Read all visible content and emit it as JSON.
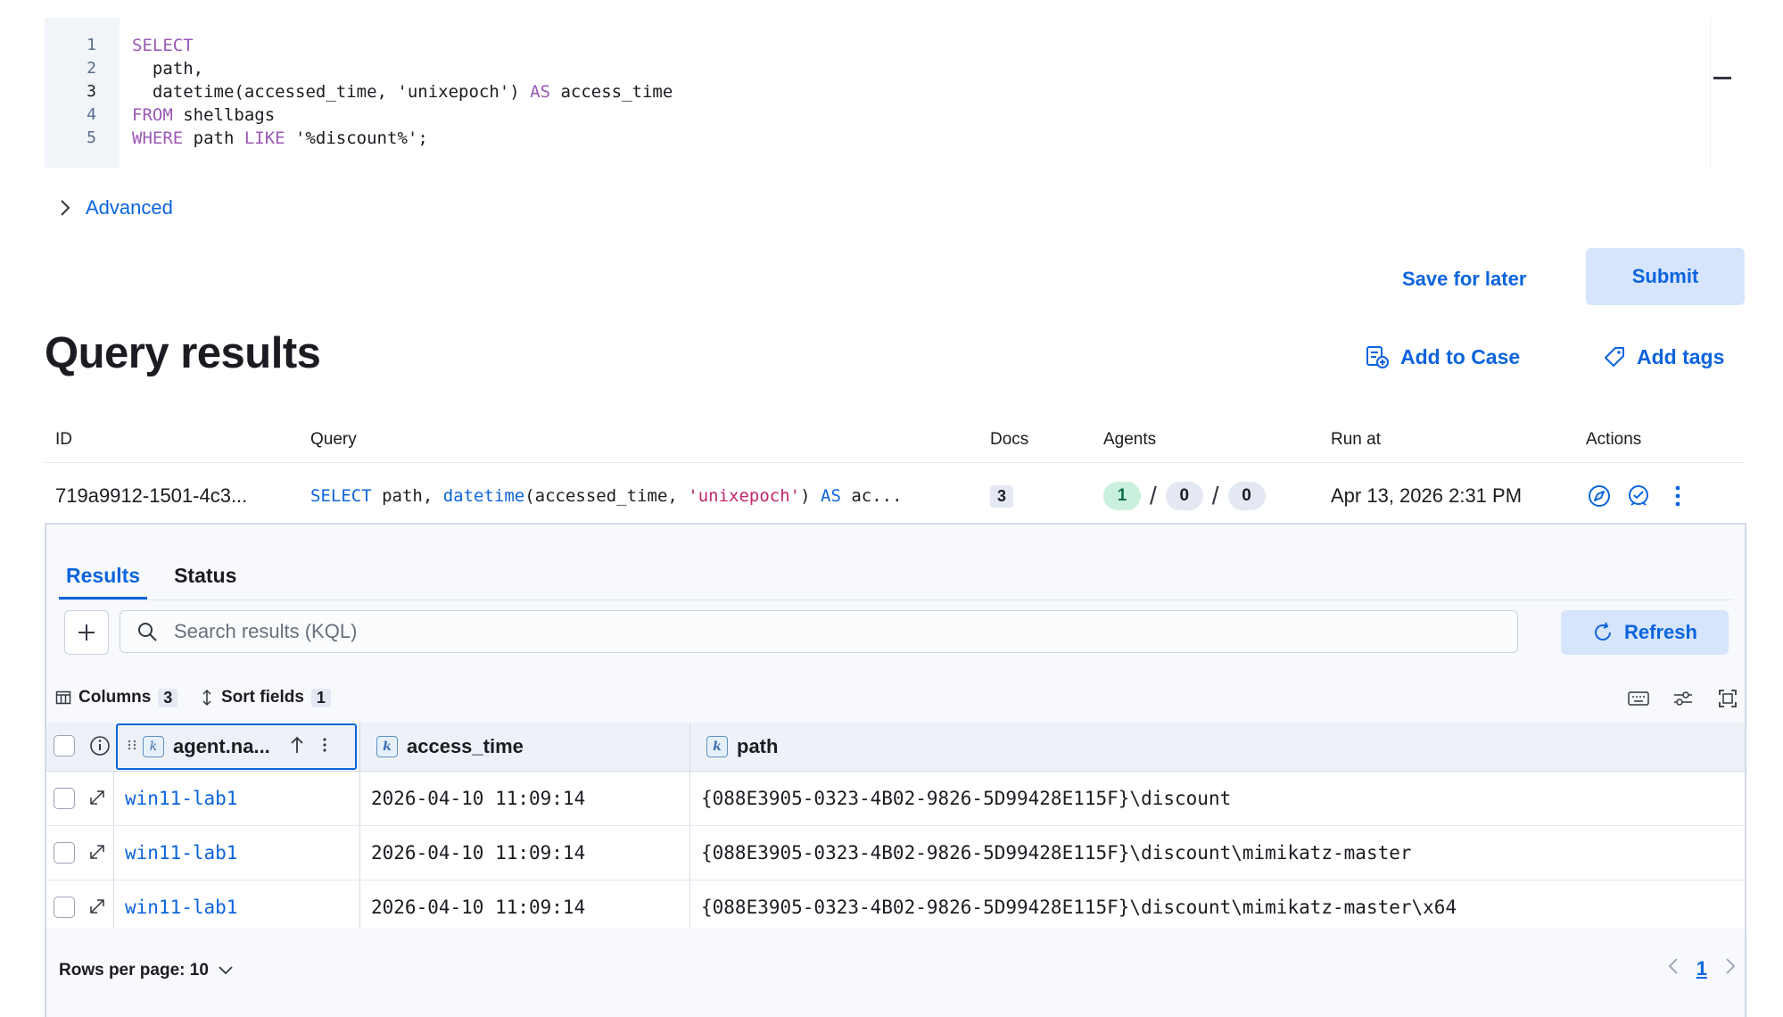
{
  "editor": {
    "lines": [
      {
        "num": "1"
      },
      {
        "num": "2"
      },
      {
        "num": "3"
      },
      {
        "num": "4"
      },
      {
        "num": "5"
      }
    ],
    "line1": {
      "kw": "SELECT"
    },
    "line2": {
      "text": "  path,"
    },
    "line3": {
      "pre": "  datetime(accessed_time, 'unixepoch') ",
      "kw": "AS",
      "post": " access_time"
    },
    "line4": {
      "kw": "FROM",
      "post": " shellbags"
    },
    "line5": {
      "kw": "WHERE",
      "mid": " path ",
      "kw2": "LIKE",
      "post": " '%discount%';"
    }
  },
  "advanced": {
    "label": "Advanced"
  },
  "actions": {
    "save_later": "Save for later",
    "submit": "Submit"
  },
  "results_header": {
    "title": "Query results",
    "add_to_case": "Add to Case",
    "add_tags": "Add tags"
  },
  "summary": {
    "headers": {
      "id": "ID",
      "query": "Query",
      "docs": "Docs",
      "agents": "Agents",
      "run_at": "Run at",
      "actions": "Actions"
    },
    "row": {
      "id": "719a9912-1501-4c3...",
      "query": {
        "select": "SELECT",
        "p1": " path, ",
        "fn": "datetime",
        "p2": "(accessed_time, ",
        "str": "'unixepoch'",
        "p3": ") ",
        "as": "AS",
        "p4": " ac..."
      },
      "docs": "3",
      "agents": {
        "success": "1",
        "pending": "0",
        "failed": "0",
        "sep": "/"
      },
      "run_at": "Apr 13, 2026 2:31 PM"
    }
  },
  "tabs": [
    {
      "label": "Results"
    },
    {
      "label": "Status"
    }
  ],
  "search": {
    "placeholder": "Search results (KQL)",
    "refresh": "Refresh"
  },
  "toolbar": {
    "columns_label": "Columns",
    "columns_count": "3",
    "sort_label": "Sort fields",
    "sort_count": "1"
  },
  "grid": {
    "columns": [
      {
        "label": "agent.na..."
      },
      {
        "label": "access_time"
      },
      {
        "label": "path"
      }
    ],
    "rows": [
      {
        "agent": "win11-lab1",
        "time": "2026-04-10 11:09:14",
        "path": "{088E3905-0323-4B02-9826-5D99428E115F}\\discount"
      },
      {
        "agent": "win11-lab1",
        "time": "2026-04-10 11:09:14",
        "path": "{088E3905-0323-4B02-9826-5D99428E115F}\\discount\\mimikatz-master"
      },
      {
        "agent": "win11-lab1",
        "time": "2026-04-10 11:09:14",
        "path": "{088E3905-0323-4B02-9826-5D99428E115F}\\discount\\mimikatz-master\\x64"
      }
    ]
  },
  "footer": {
    "rows_per_page": "Rows per page: 10",
    "page": "1"
  },
  "colors": {
    "accent": "#0b64dd",
    "success_pill": "#c9f0dd",
    "keyword": "#9b59b6",
    "string": "#c0266d"
  },
  "icons": [
    "chevron-right-icon",
    "add-to-case-icon",
    "tag-icon",
    "discover-icon",
    "lens-icon",
    "more-vertical-icon",
    "plus-icon",
    "search-icon",
    "refresh-icon",
    "columns-icon",
    "sort-icon",
    "keyboard-icon",
    "display-settings-icon",
    "fullscreen-icon",
    "info-icon",
    "drag-handle-icon",
    "sort-ascending-icon",
    "expand-icon",
    "chevron-down-icon",
    "chevron-left-icon"
  ]
}
